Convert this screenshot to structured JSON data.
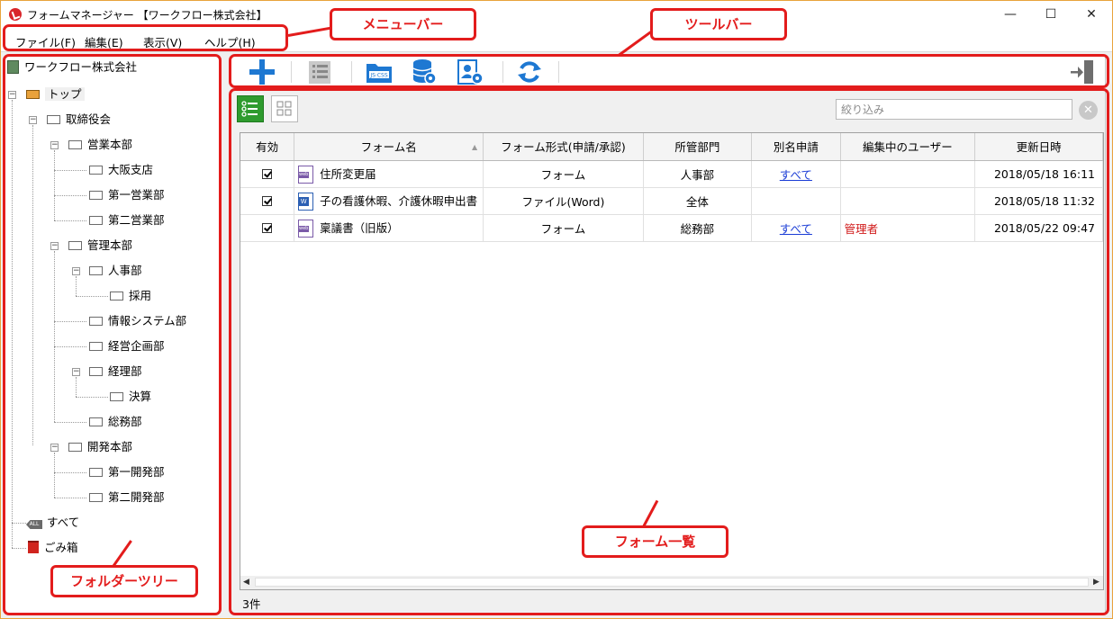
{
  "window": {
    "title": "フォームマネージャー 【ワークフロー株式会社】",
    "controls": [
      "—",
      "☐",
      "✕"
    ]
  },
  "menu": [
    "ファイル(F)",
    "編集(E)",
    "表示(V)",
    "ヘルプ(H)"
  ],
  "tree": {
    "root": "ワークフロー株式会社",
    "nodes": {
      "top": "トップ",
      "board": "取締役会",
      "sales_hq": "営業本部",
      "osaka": "大阪支店",
      "sales1": "第一営業部",
      "sales2": "第二営業部",
      "admin_hq": "管理本部",
      "hr": "人事部",
      "recruit": "採用",
      "it": "情報システム部",
      "planning": "経営企画部",
      "accounting": "経理部",
      "settlement": "決算",
      "general": "総務部",
      "dev_hq": "開発本部",
      "dev1": "第一開発部",
      "dev2": "第二開発部",
      "all": "すべて",
      "trash": "ごみ箱"
    },
    "all_badge": "ALL"
  },
  "toolbar": {
    "buttons": [
      "add-icon",
      "list-form-icon",
      "js-css-folder-icon",
      "database-settings-icon",
      "user-settings-icon",
      "refresh-icon",
      "exit-icon"
    ],
    "js_css_label": "JS·CSS"
  },
  "list": {
    "filter_placeholder": "絞り込み",
    "clear": "✕",
    "columns": [
      "有効",
      "フォーム形式(申請/承認)",
      "所管部門",
      "別名申請",
      "編集中のユーザー",
      "更新日時"
    ],
    "name_column": "フォーム名",
    "rows": [
      {
        "enabled": true,
        "icon": "web-form-icon",
        "name": "住所変更届",
        "type": "フォーム",
        "dept": "人事部",
        "alias": "すべて",
        "editor": "",
        "updated": "2018/05/18 16:11"
      },
      {
        "enabled": true,
        "icon": "word-file-icon",
        "name": "子の看護休暇、介護休暇申出書",
        "type": "ファイル(Word)",
        "dept": "全体",
        "alias": "",
        "editor": "",
        "updated": "2018/05/18 11:32"
      },
      {
        "enabled": true,
        "icon": "web-form-icon",
        "name": "稟議書（旧版）",
        "type": "フォーム",
        "dept": "総務部",
        "alias": "すべて",
        "editor": "管理者",
        "updated": "2018/05/22 09:47"
      }
    ],
    "count": "3件"
  },
  "annotations": {
    "menubar": "メニューバー",
    "toolbar": "ツールバー",
    "form_list": "フォーム一覧",
    "folder_tree": "フォルダーツリー"
  },
  "colors": {
    "annotation": "#e31c1c",
    "accent_blue": "#1e78d2",
    "active_view": "#2e9b2e",
    "window_border": "#e8a33c"
  }
}
